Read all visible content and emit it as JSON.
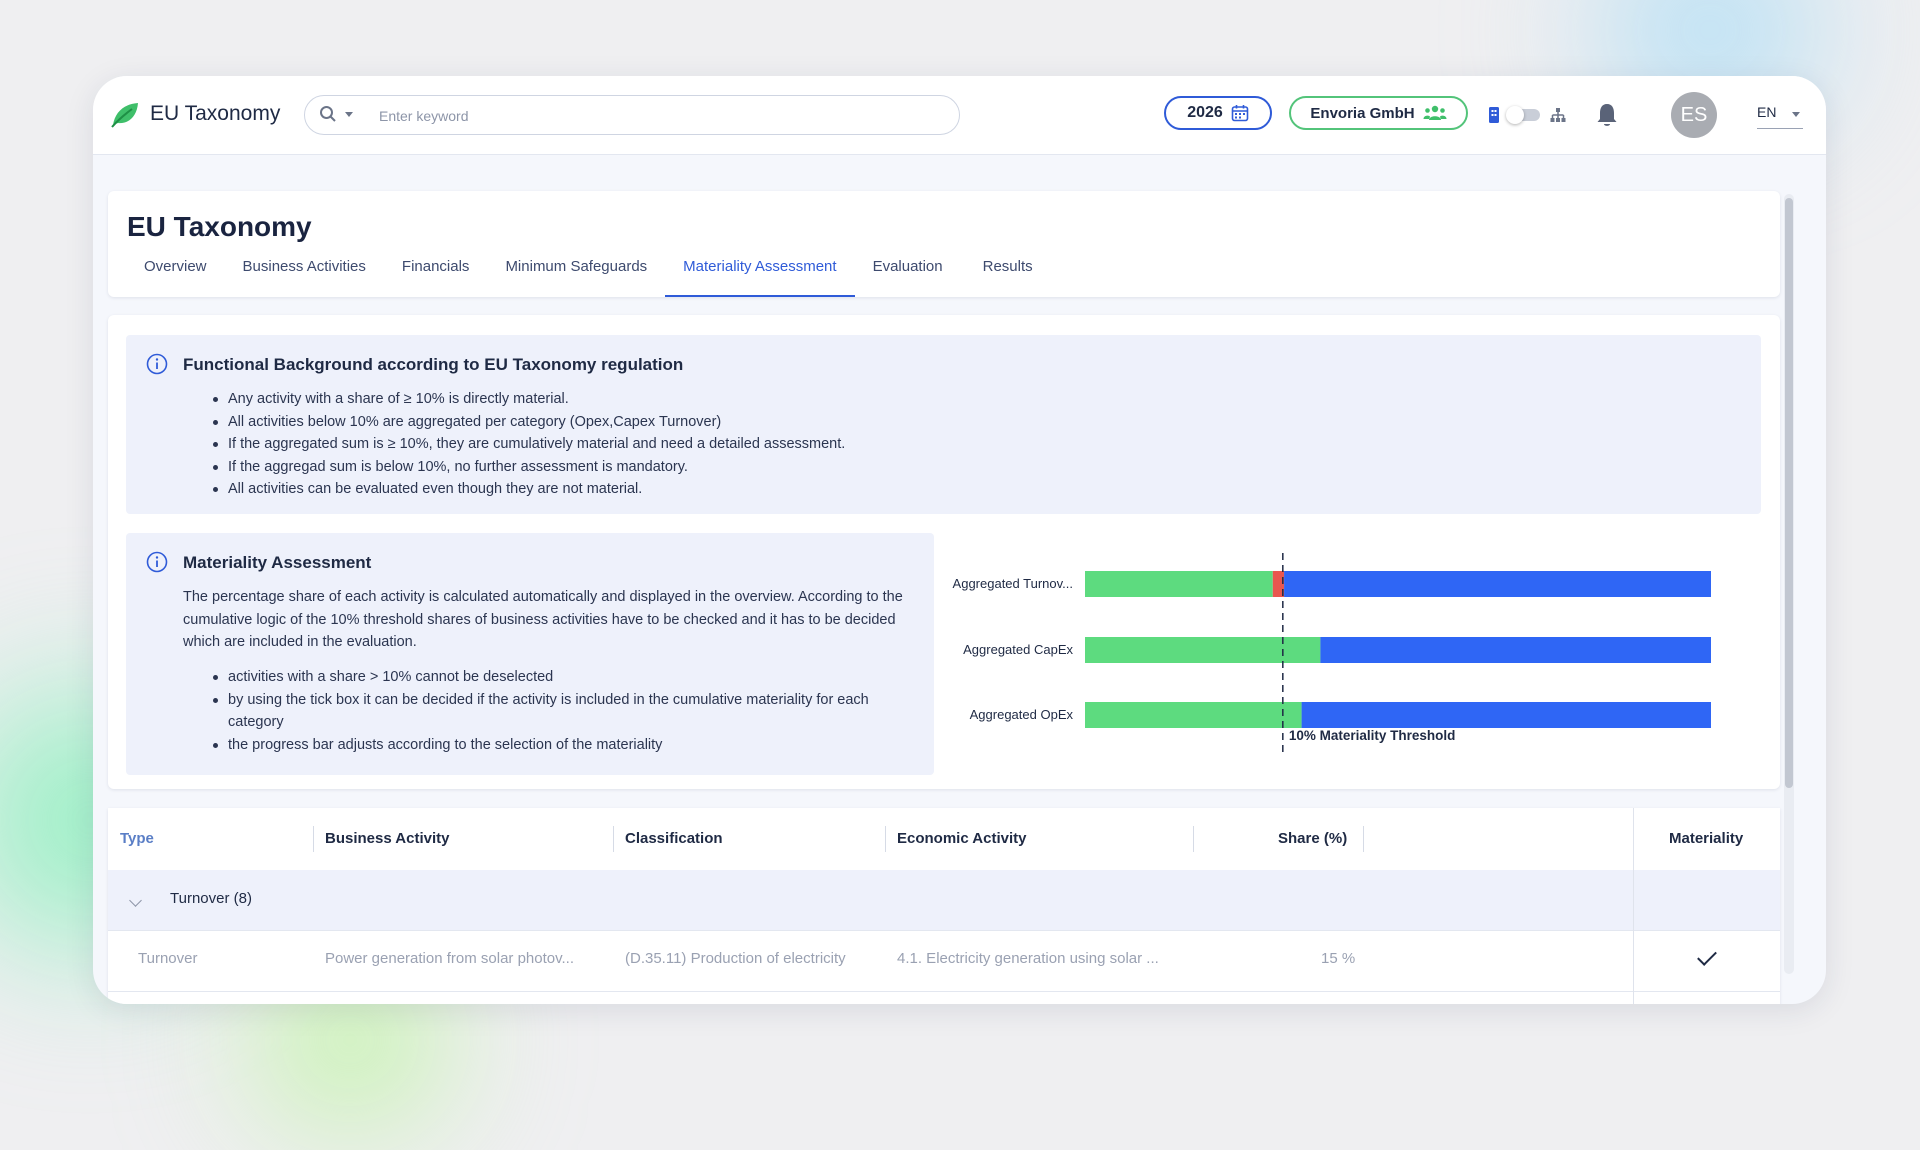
{
  "app": {
    "title": "EU Taxonomy"
  },
  "search": {
    "placeholder": "Enter keyword"
  },
  "header": {
    "year": "2026",
    "company": "Envoria GmbH",
    "avatar_initials": "ES",
    "language": "EN"
  },
  "page": {
    "title": "EU Taxonomy",
    "tabs": [
      {
        "label": "Overview"
      },
      {
        "label": "Business Activities"
      },
      {
        "label": "Financials"
      },
      {
        "label": "Minimum Safeguards"
      },
      {
        "label": "Materiality Assessment",
        "active": true
      },
      {
        "label": "Evaluation"
      },
      {
        "label": "Results"
      }
    ]
  },
  "background_info": {
    "title": "Functional Background according to EU Taxonomy regulation",
    "items": [
      "Any activity with a share of ≥ 10% is directly material.",
      "All activities below 10% are aggregated per category (Opex,Capex Turnover)",
      "If the aggregated sum is ≥ 10%, they are cumulatively material and need a detailed assessment.",
      "If the aggregad sum is below 10%, no further assessment is mandatory.",
      "All activities can be evaluated even though they are not material."
    ]
  },
  "materiality_info": {
    "title": "Materiality Assessment",
    "paragraph": "The percentage share of each activity is calculated automatically and displayed in the overview. According to the cumulative logic of the 10% threshold shares of business activities have to be checked and it has to be decided which are included in the evaluation.",
    "items": [
      "activities with a share > 10% cannot be deselected",
      "by using the tick box it can be decided if the activity is included in the cumulative materiality for each category",
      "the progress bar adjusts according to the selection of the materiality"
    ]
  },
  "chart_data": {
    "type": "bar",
    "orientation": "horizontal",
    "stacked": true,
    "categories": [
      "Aggregated Turnov...",
      "Aggregated CapEx",
      "Aggregated OpEx"
    ],
    "series": [
      {
        "color": "#5ddb7f",
        "values": [
          30.0,
          37.6,
          34.6
        ]
      },
      {
        "color": "#e8574f",
        "values": [
          1.8,
          0,
          0
        ]
      },
      {
        "color": "#2f66f5",
        "values": [
          68.2,
          62.4,
          65.4
        ]
      }
    ],
    "xlim": [
      0,
      100
    ],
    "threshold": {
      "value": 31.6,
      "label": "10% Materiality Threshold"
    }
  },
  "table": {
    "columns": [
      "Type",
      "Business Activity",
      "Classification",
      "Economic Activity",
      "Share (%)",
      "Materiality"
    ],
    "group": {
      "label": "Turnover (8)"
    },
    "rows": [
      {
        "type": "Turnover",
        "business_activity": "Power generation from solar photov...",
        "classification": "(D.35.11) Production of electricity",
        "economic_activity": "4.1. Electricity generation using solar ...",
        "share": "15 %",
        "material": true
      }
    ]
  }
}
